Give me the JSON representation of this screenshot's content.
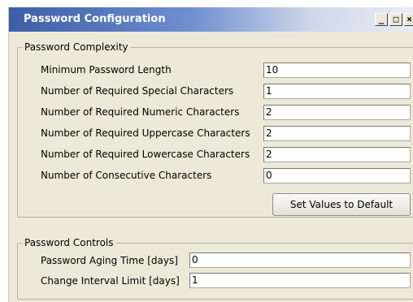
{
  "window": {
    "title": "Password Configuration",
    "controls": {
      "minimize": "_",
      "maximize": "□",
      "close": "×"
    }
  },
  "complexity": {
    "legend": "Password Complexity",
    "fields": [
      {
        "label": "Minimum Password Length",
        "value": "10"
      },
      {
        "label": "Number of Required Special Characters",
        "value": "1"
      },
      {
        "label": "Number of Required Numeric Characters",
        "value": "2"
      },
      {
        "label": "Number of Required Uppercase Characters",
        "value": "2"
      },
      {
        "label": "Number of Required Lowercase Characters",
        "value": "2"
      },
      {
        "label": "Number of Consecutive Characters",
        "value": "0"
      }
    ],
    "default_button": "Set Values to Default"
  },
  "controls": {
    "legend": "Password Controls",
    "fields": [
      {
        "label": "Password Aging Time [days]",
        "value": "0"
      },
      {
        "label": "Change Interval Limit [days]",
        "value": "1"
      }
    ]
  }
}
